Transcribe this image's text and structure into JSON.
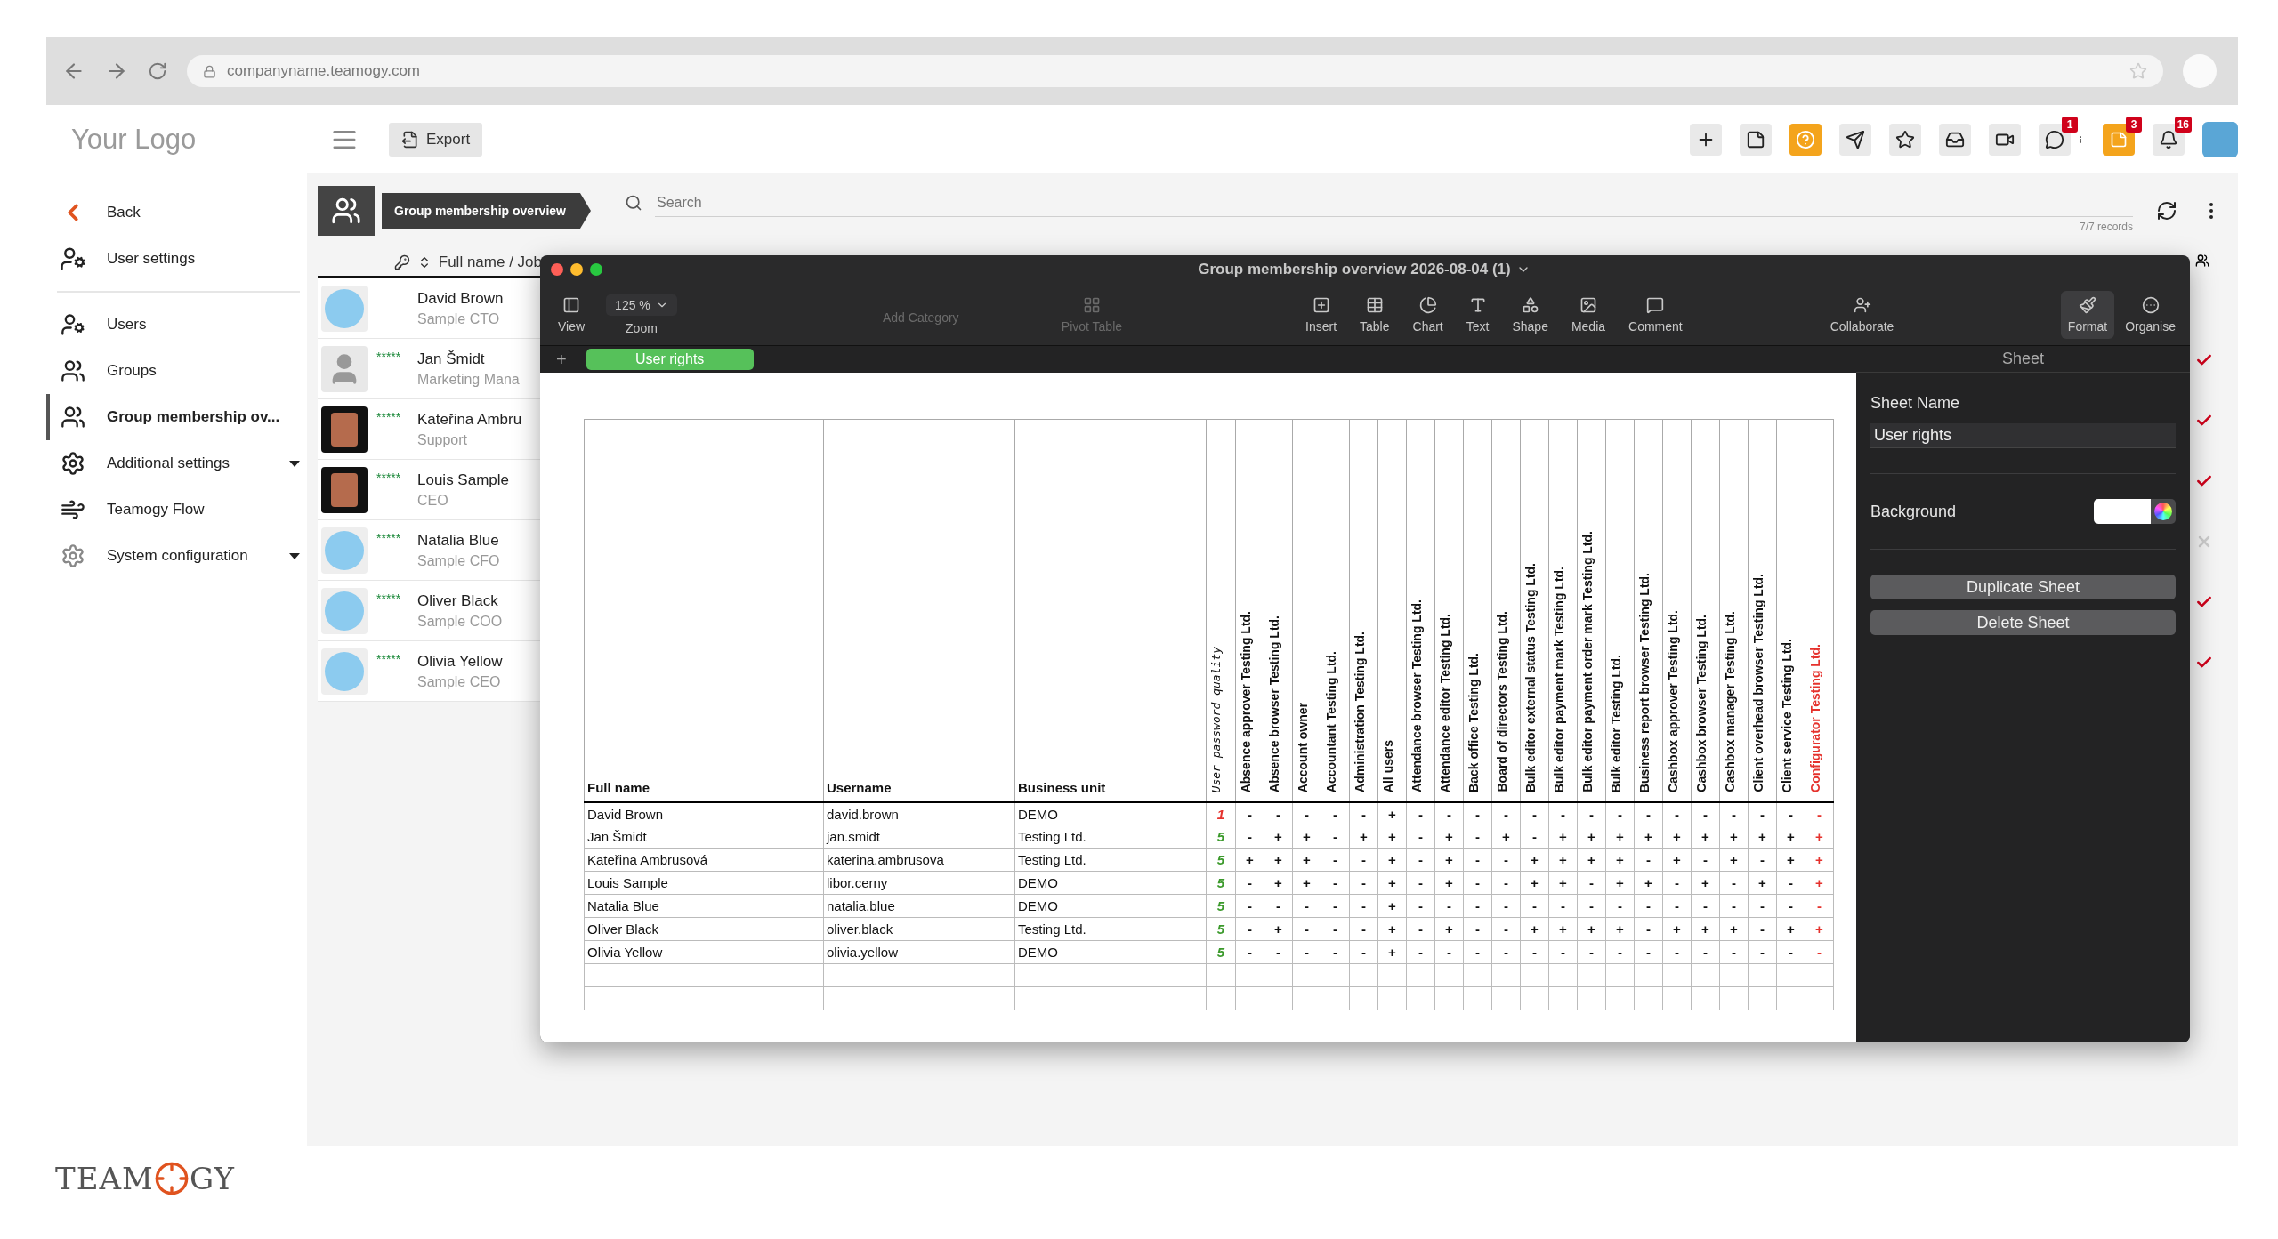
{
  "browser": {
    "url": "companyname.teamogy.com"
  },
  "header": {
    "logo": "Your Logo",
    "export_button": "Export",
    "badges": {
      "messages": "1",
      "tasks": "3",
      "notifications": "16"
    }
  },
  "sidebar": {
    "back": "Back",
    "settings_title": "User settings",
    "items": [
      {
        "label": "Users",
        "selected": false,
        "has_submenu": false
      },
      {
        "label": "Groups",
        "selected": false,
        "has_submenu": false
      },
      {
        "label": "Group membership ov...",
        "selected": true,
        "has_submenu": false
      },
      {
        "label": "Additional settings",
        "selected": false,
        "has_submenu": true
      },
      {
        "label": "Teamogy Flow",
        "selected": false,
        "has_submenu": false
      },
      {
        "label": "System configuration",
        "selected": false,
        "has_submenu": true
      }
    ]
  },
  "page": {
    "title": "Group membership overview",
    "search": {
      "placeholder": "Search"
    },
    "records": "7/7 records"
  },
  "list": {
    "column": "Full name / Job",
    "people": [
      {
        "name": "David Brown",
        "job": "Sample CTO",
        "kind": "photo"
      },
      {
        "name": "Jan Šmidt",
        "job": "Marketing Mana",
        "rating": "*****",
        "kind": "silhouette"
      },
      {
        "name": "Kateřina Ambru",
        "job": "Support",
        "rating": "*****",
        "kind": "framed"
      },
      {
        "name": "Louis Sample",
        "job": "CEO",
        "rating": "*****",
        "kind": "framed"
      },
      {
        "name": "Natalia Blue",
        "job": "Sample CFO",
        "rating": "*****",
        "kind": "photo"
      },
      {
        "name": "Oliver Black",
        "job": "Sample COO",
        "rating": "*****",
        "kind": "photo"
      },
      {
        "name": "Olivia Yellow",
        "job": "Sample CEO",
        "rating": "*****",
        "kind": "photo"
      }
    ]
  },
  "edge_marks": [
    {
      "checked": true
    },
    {
      "checked": true
    },
    {
      "checked": true
    },
    {
      "checked": false
    },
    {
      "checked": true
    },
    {
      "checked": true
    }
  ],
  "window": {
    "title": "Group membership overview 2026-08-04 (1)",
    "toolbar_groups": [
      {
        "items": [
          {
            "kind": "button",
            "label": "View",
            "disabled": false,
            "selected": false
          },
          {
            "kind": "dropdown",
            "label": "Zoom",
            "value": "125 %"
          }
        ]
      },
      {
        "items": [
          {
            "kind": "button",
            "label": "Add Category",
            "disabled": true,
            "selected": false
          },
          {
            "kind": "button",
            "label": "Pivot Table",
            "disabled": true,
            "selected": false
          }
        ]
      },
      {
        "items": [
          {
            "kind": "button",
            "label": "Insert",
            "disabled": false,
            "selected": false
          },
          {
            "kind": "button",
            "label": "Table",
            "disabled": false,
            "selected": false
          },
          {
            "kind": "button",
            "label": "Chart",
            "disabled": false,
            "selected": false
          },
          {
            "kind": "button",
            "label": "Text",
            "disabled": false,
            "selected": false
          },
          {
            "kind": "button",
            "label": "Shape",
            "disabled": false,
            "selected": false
          },
          {
            "kind": "button",
            "label": "Media",
            "disabled": false,
            "selected": false
          },
          {
            "kind": "button",
            "label": "Comment",
            "disabled": false,
            "selected": false
          }
        ]
      },
      {
        "items": [
          {
            "kind": "button",
            "label": "Collaborate",
            "disabled": false,
            "selected": false
          }
        ]
      },
      {
        "items": [
          {
            "kind": "button",
            "label": "Format",
            "disabled": false,
            "selected": true
          },
          {
            "kind": "button",
            "label": "Organise",
            "disabled": false,
            "selected": false
          }
        ]
      }
    ],
    "add_sheet": "+",
    "sheet_tabs": [
      {
        "label": "User rights",
        "selected": true
      }
    ],
    "inspector": {
      "title": "Sheet",
      "sheet_name_label": "Sheet Name",
      "sheet_name": "User rights",
      "background_label": "Background",
      "buttons": [
        "Duplicate Sheet",
        "Delete Sheet"
      ]
    }
  },
  "table": {
    "columns": [
      {
        "label": "Full name",
        "kind": "text"
      },
      {
        "label": "Username",
        "kind": "text"
      },
      {
        "label": "Business unit",
        "kind": "text"
      },
      {
        "label": "User password quality",
        "kind": "quality"
      },
      {
        "label": "Absence approver Testing Ltd.",
        "kind": "group"
      },
      {
        "label": "Absence browser Testing Ltd.",
        "kind": "group"
      },
      {
        "label": "Account owner",
        "kind": "group"
      },
      {
        "label": "Accountant Testing Ltd.",
        "kind": "group"
      },
      {
        "label": "Administration Testing Ltd.",
        "kind": "group"
      },
      {
        "label": "All users",
        "kind": "group"
      },
      {
        "label": "Attendance browser Testing Ltd.",
        "kind": "group"
      },
      {
        "label": "Attendance editor Testing Ltd.",
        "kind": "group"
      },
      {
        "label": "Back office Testing Ltd.",
        "kind": "group"
      },
      {
        "label": "Board of directors Testing Ltd.",
        "kind": "group"
      },
      {
        "label": "Bulk editor external status Testing Ltd.",
        "kind": "group"
      },
      {
        "label": "Bulk editor payment mark Testing Ltd.",
        "kind": "group"
      },
      {
        "label": "Bulk editor payment order mark Testing Ltd.",
        "kind": "group"
      },
      {
        "label": "Bulk editor Testing Ltd.",
        "kind": "group"
      },
      {
        "label": "Business report browser Testing Ltd.",
        "kind": "group"
      },
      {
        "label": "Cashbox approver Testing Ltd.",
        "kind": "group"
      },
      {
        "label": "Cashbox browser Testing Ltd.",
        "kind": "group"
      },
      {
        "label": "Cashbox manager Testing Ltd.",
        "kind": "group"
      },
      {
        "label": "Client overhead browser Testing Ltd.",
        "kind": "group"
      },
      {
        "label": "Client service Testing Ltd.",
        "kind": "group"
      },
      {
        "label": "Configurator Testing Ltd.",
        "kind": "flagged"
      }
    ],
    "rows": [
      {
        "cells": [
          "David Brown",
          "david.brown",
          "DEMO"
        ],
        "quality": "1",
        "quality_ok": false,
        "rights": [
          "-",
          "-",
          "-",
          "-",
          "-",
          "+",
          "-",
          "-",
          "-",
          "-",
          "-",
          "-",
          "-",
          "-",
          "-",
          "-",
          "-",
          "-",
          "-",
          "-",
          "-"
        ]
      },
      {
        "cells": [
          "Jan Šmidt",
          "jan.smidt",
          "Testing Ltd."
        ],
        "quality": "5",
        "quality_ok": true,
        "rights": [
          "-",
          "+",
          "+",
          "-",
          "+",
          "+",
          "-",
          "+",
          "-",
          "+",
          "-",
          "+",
          "+",
          "+",
          "+",
          "+",
          "+",
          "+",
          "+",
          "+",
          "+"
        ]
      },
      {
        "cells": [
          "Kateřina Ambrusová",
          "katerina.ambrusova",
          "Testing Ltd."
        ],
        "quality": "5",
        "quality_ok": true,
        "rights": [
          "+",
          "+",
          "+",
          "-",
          "-",
          "+",
          "-",
          "+",
          "-",
          "-",
          "+",
          "+",
          "+",
          "+",
          "-",
          "+",
          "-",
          "+",
          "-",
          "+",
          "+"
        ]
      },
      {
        "cells": [
          "Louis Sample",
          "libor.cerny",
          "DEMO"
        ],
        "quality": "5",
        "quality_ok": true,
        "rights": [
          "-",
          "+",
          "+",
          "-",
          "-",
          "+",
          "-",
          "+",
          "-",
          "-",
          "+",
          "+",
          "-",
          "+",
          "+",
          "-",
          "+",
          "-",
          "+",
          "-",
          "+"
        ]
      },
      {
        "cells": [
          "Natalia Blue",
          "natalia.blue",
          "DEMO"
        ],
        "quality": "5",
        "quality_ok": true,
        "rights": [
          "-",
          "-",
          "-",
          "-",
          "-",
          "+",
          "-",
          "-",
          "-",
          "-",
          "-",
          "-",
          "-",
          "-",
          "-",
          "-",
          "-",
          "-",
          "-",
          "-",
          "-"
        ]
      },
      {
        "cells": [
          "Oliver Black",
          "oliver.black",
          "Testing Ltd."
        ],
        "quality": "5",
        "quality_ok": true,
        "rights": [
          "-",
          "+",
          "-",
          "-",
          "-",
          "+",
          "-",
          "+",
          "-",
          "-",
          "+",
          "+",
          "+",
          "+",
          "-",
          "+",
          "+",
          "+",
          "-",
          "+",
          "+"
        ]
      },
      {
        "cells": [
          "Olivia Yellow",
          "olivia.yellow",
          "DEMO"
        ],
        "quality": "5",
        "quality_ok": true,
        "rights": [
          "-",
          "-",
          "-",
          "-",
          "-",
          "+",
          "-",
          "-",
          "-",
          "-",
          "-",
          "-",
          "-",
          "-",
          "-",
          "-",
          "-",
          "-",
          "-",
          "-",
          "-"
        ]
      }
    ]
  },
  "footer_logo": {
    "left": "TEAM",
    "right": "GY"
  }
}
